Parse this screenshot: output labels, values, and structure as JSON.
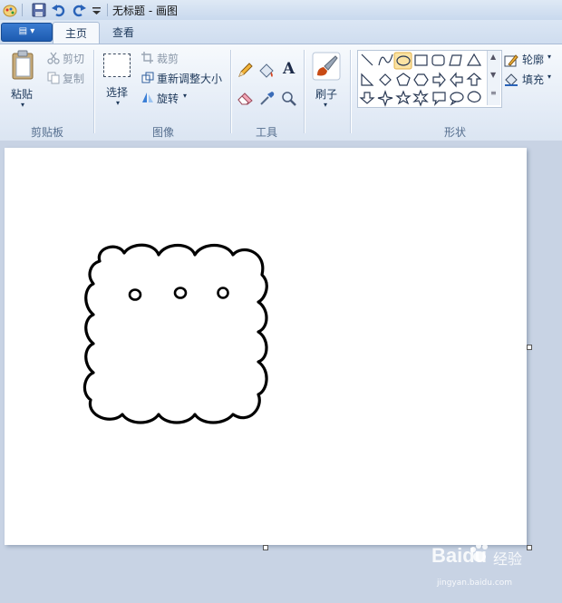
{
  "window": {
    "title": "无标题 - 画图"
  },
  "tabs": {
    "file_label": "▤ ▾",
    "home": "主页",
    "view": "查看"
  },
  "clipboard": {
    "paste": "粘贴",
    "cut": "剪切",
    "copy": "复制",
    "group": "剪贴板"
  },
  "image": {
    "select": "选择",
    "crop": "裁剪",
    "resize": "重新调整大小",
    "rotate": "旋转",
    "group": "图像"
  },
  "tools": {
    "group": "工具",
    "text_tool": "A"
  },
  "brushes": {
    "label": "刷子"
  },
  "shapes": {
    "outline": "轮廓",
    "fill": "填充",
    "group": "形状"
  },
  "watermark": {
    "brand": "Baidu",
    "suffix": "经验",
    "url": "jingyan.baidu.com"
  },
  "colors": {
    "accent": "#1d5bb0",
    "selected_shape": "#fbe3a3",
    "canvas": "#ffffff",
    "workspace": "#c8d3e4"
  }
}
